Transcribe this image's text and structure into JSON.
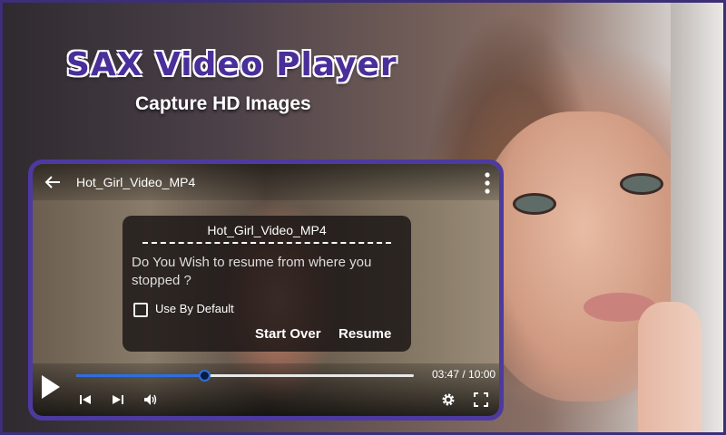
{
  "banner": {
    "title": "SAX Video Player",
    "subtitle": "Capture HD Images"
  },
  "player": {
    "video_title": "Hot_Girl_Video_MP4",
    "time_display": "03:47 / 10:00",
    "progress_fraction": 0.379,
    "icons": [
      "back-arrow-icon",
      "more-vert-icon",
      "play-icon",
      "skip-previous-icon",
      "skip-next-icon",
      "volume-icon",
      "gear-icon",
      "fullscreen-icon"
    ]
  },
  "dialog": {
    "title": "Hot_Girl_Video_MP4",
    "message": "Do You Wish to resume from where you stopped ?",
    "checkbox_label": "Use By Default",
    "checkbox_checked": false,
    "start_over_label": "Start Over",
    "resume_label": "Resume"
  },
  "colors": {
    "accent": "#4d3aa0",
    "title_purple": "#4a2e9a",
    "seek_blue": "#2d6fe0"
  }
}
